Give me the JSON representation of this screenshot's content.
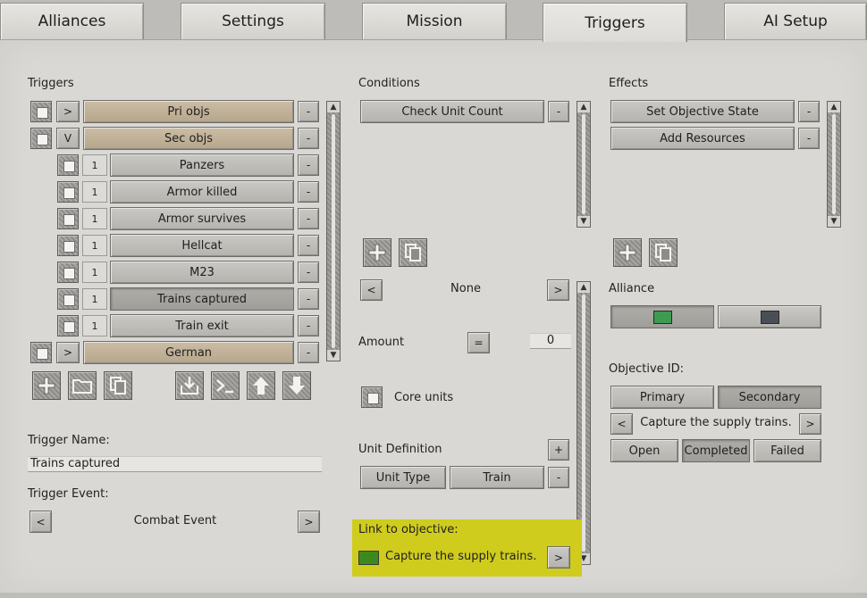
{
  "tabs": [
    "Alliances",
    "Settings",
    "Mission",
    "Triggers",
    "AI Setup"
  ],
  "triggers": {
    "heading": "Triggers",
    "rows": [
      {
        "toggle": ">",
        "label": "Pri objs"
      },
      {
        "toggle": "V",
        "label": "Sec objs"
      },
      {
        "num": "1",
        "label": "Panzers"
      },
      {
        "num": "1",
        "label": "Armor killed"
      },
      {
        "num": "1",
        "label": "Armor survives"
      },
      {
        "num": "1",
        "label": "Hellcat"
      },
      {
        "num": "1",
        "label": "M23"
      },
      {
        "num": "1",
        "label": "Trains captured"
      },
      {
        "num": "1",
        "label": "Train exit"
      },
      {
        "toggle": ">",
        "label": "German"
      }
    ],
    "remove": "-",
    "name_label": "Trigger Name:",
    "name_value": "Trains captured",
    "event_label": "Trigger Event:",
    "event_value": "Combat Event",
    "prev": "<",
    "next": ">"
  },
  "conditions": {
    "heading": "Conditions",
    "items": [
      "Check Unit Count"
    ],
    "remove": "-",
    "selector_value": "None",
    "prev": "<",
    "next": ">",
    "amount_label": "Amount",
    "operator": "=",
    "amount_value": "0",
    "core_units_label": "Core units",
    "unit_def_label": "Unit Definition",
    "add": "+",
    "unit_type_label": "Unit Type",
    "unit_type_value": "Train",
    "link_label": "Link to objective:",
    "link_value": "Capture the supply trains.",
    "link_color": "#3c8a1e",
    "highlight_color": "#cfcc1d"
  },
  "effects": {
    "heading": "Effects",
    "items": [
      "Set Objective State",
      "Add Resources"
    ],
    "remove": "-",
    "alliance_label": "Alliance",
    "alliance_colors": [
      "#3f9a52",
      "#4a4f57"
    ],
    "objective_id_label": "Objective ID:",
    "objective_types": [
      "Primary",
      "Secondary"
    ],
    "objective_value": "Capture the supply trains.",
    "prev": "<",
    "next": ">",
    "states": [
      "Open",
      "Completed",
      "Failed"
    ]
  }
}
